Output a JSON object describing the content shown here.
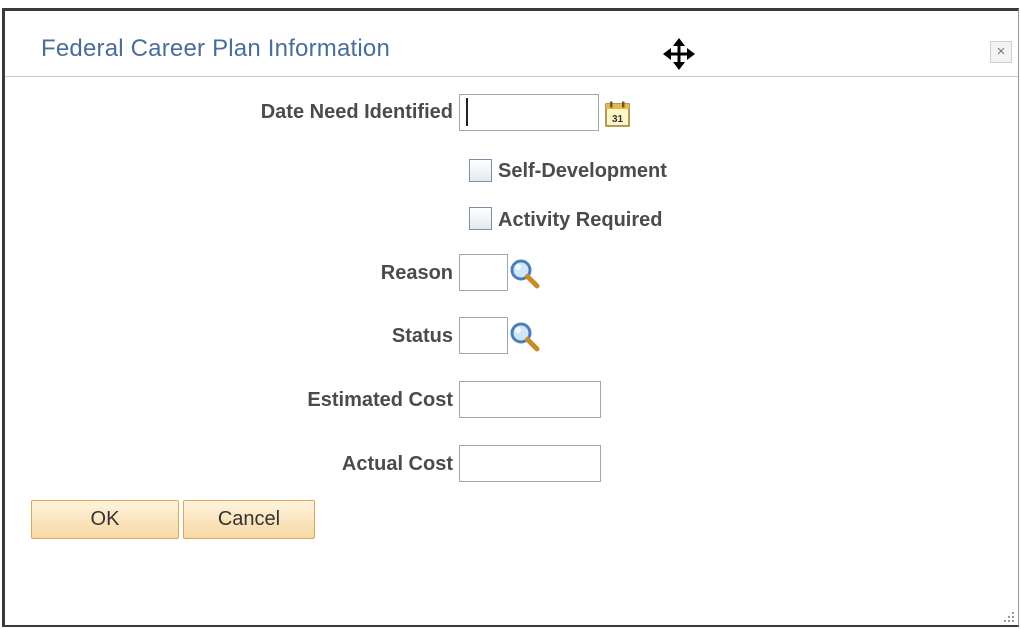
{
  "dialog": {
    "title": "Federal Career Plan Information",
    "close_label": "×"
  },
  "form": {
    "date_need_identified": {
      "label": "Date Need Identified",
      "value": ""
    },
    "self_development": {
      "label": "Self-Development",
      "checked": false
    },
    "activity_required": {
      "label": "Activity Required",
      "checked": false
    },
    "reason": {
      "label": "Reason",
      "value": ""
    },
    "status": {
      "label": "Status",
      "value": ""
    },
    "estimated_cost": {
      "label": "Estimated Cost",
      "value": ""
    },
    "actual_cost": {
      "label": "Actual Cost",
      "value": ""
    }
  },
  "buttons": {
    "ok": "OK",
    "cancel": "Cancel"
  },
  "icons": {
    "calendar": "calendar-icon",
    "lookup": "magnifier-icon",
    "move": "move-cursor-icon",
    "resize": "resize-grip-icon"
  },
  "calendar_icon_text": "31",
  "colors": {
    "title": "#4a6e9b",
    "button_border": "#d9a85a",
    "button_fill": "#f7d8a4"
  }
}
